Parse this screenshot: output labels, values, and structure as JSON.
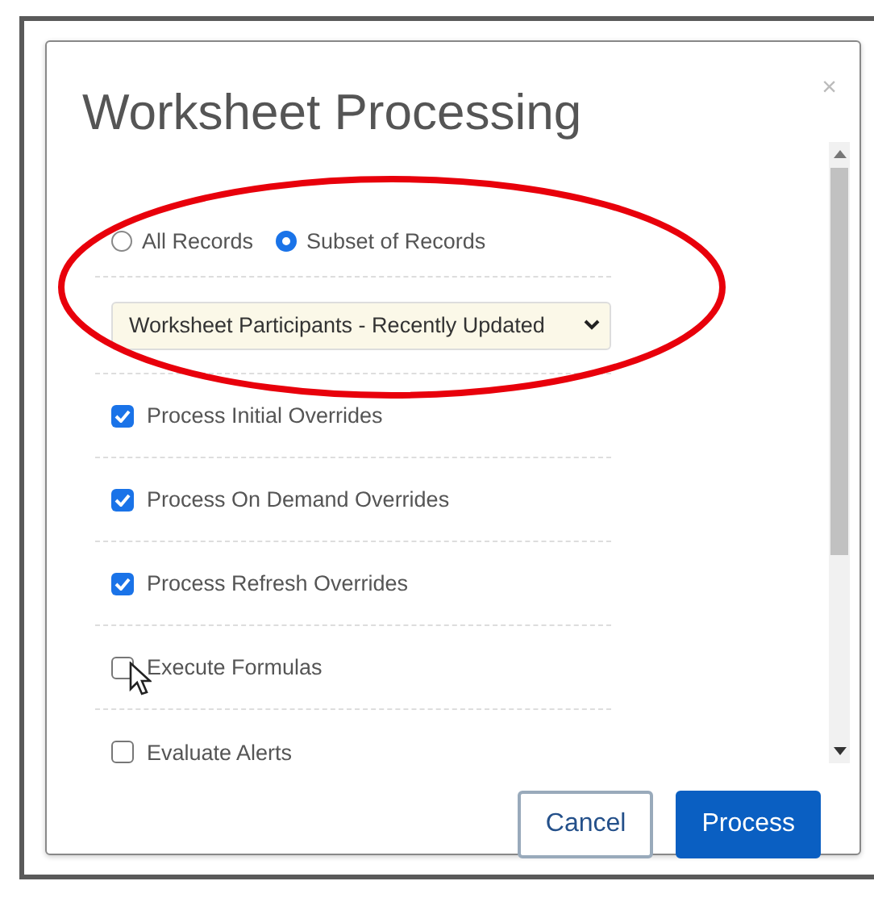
{
  "dialog": {
    "title": "Worksheet Processing",
    "close": "×"
  },
  "scope": [
    {
      "label": "All Records",
      "selected": false
    },
    {
      "label": "Subset of Records",
      "selected": true
    }
  ],
  "subset_select": {
    "value": "Worksheet Participants - Recently Updated"
  },
  "options": [
    {
      "label": "Process Initial Overrides",
      "checked": true
    },
    {
      "label": "Process On Demand Overrides",
      "checked": true
    },
    {
      "label": "Process Refresh Overrides",
      "checked": true
    },
    {
      "label": "Execute Formulas",
      "checked": false
    },
    {
      "label": "Evaluate Alerts",
      "checked": false
    }
  ],
  "buttons": [
    {
      "label": "Cancel",
      "kind": "secondary"
    },
    {
      "label": "Process",
      "kind": "primary"
    }
  ]
}
